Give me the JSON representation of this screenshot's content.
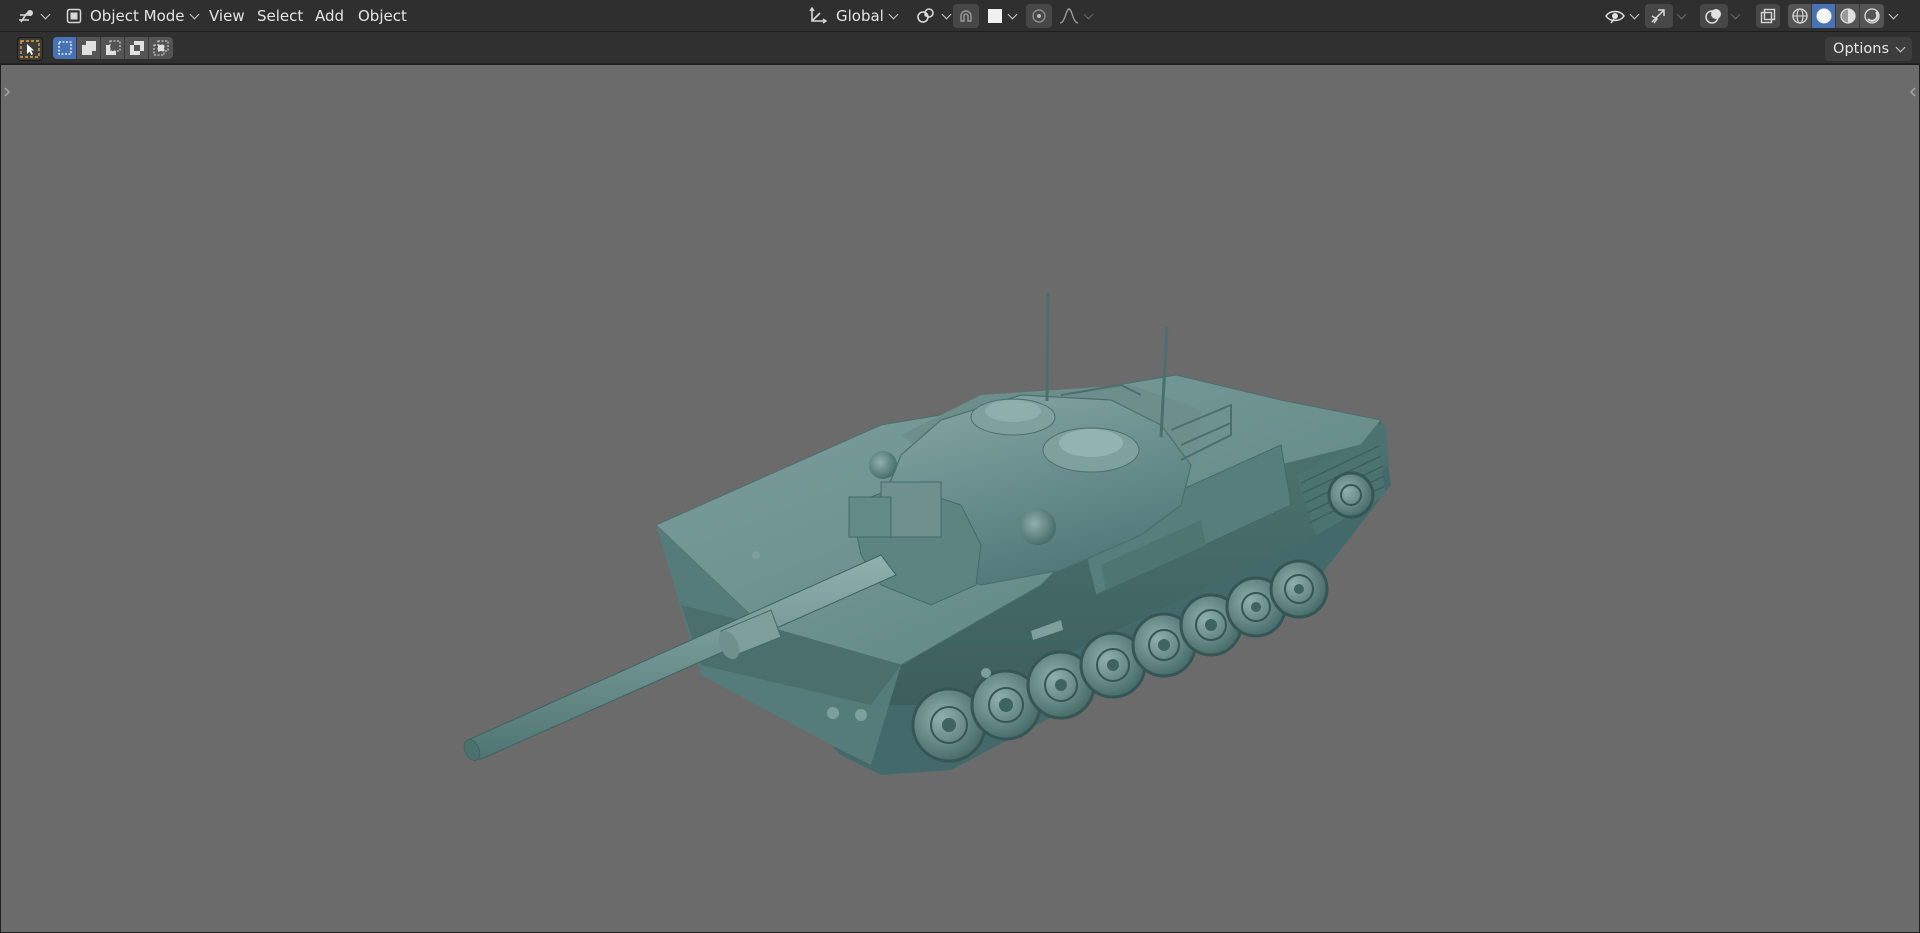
{
  "header": {
    "editor_type_icon": "viewport-gizmo-icon",
    "mode_icon": "object-mode-icon",
    "mode_label": "Object Mode",
    "menus": [
      "View",
      "Select",
      "Add",
      "Object"
    ],
    "transform_orientation_icon": "axes-orientation-icon",
    "transform_orientation_label": "Global",
    "pivot_icon": "pivot-point-icon",
    "snap_icon": "magnet-snap-icon",
    "snap_target_icon": "snap-increment-icon",
    "proportional_edit_icon": "proportional-edit-icon",
    "falloff_icon": "falloff-curve-icon",
    "visibility_icon": "eye-visibility-icon",
    "gizmo_icon": "gizmo-arrow-icon",
    "overlays_icon": "overlays-icon",
    "xray_icon": "xray-toggle-icon",
    "shading_modes": [
      {
        "name": "wireframe-shading-icon"
      },
      {
        "name": "solid-shading-icon",
        "active": true
      },
      {
        "name": "material-preview-icon"
      },
      {
        "name": "rendered-shading-icon"
      }
    ]
  },
  "toolbar": {
    "active_tool_icon": "select-box-tool-icon",
    "selection_modes": [
      {
        "name": "select-new-icon",
        "active": true
      },
      {
        "name": "select-extend-icon"
      },
      {
        "name": "select-subtract-icon"
      },
      {
        "name": "select-invert-icon"
      },
      {
        "name": "select-intersect-icon"
      }
    ],
    "options_label": "Options"
  },
  "viewport": {
    "background_color": "#6b6b6b",
    "model_color": "#5f8785",
    "model_name": "tank-model"
  },
  "colors": {
    "accent": "#4772b3",
    "header_bg": "#2f2f2f",
    "tool_highlight": "#e8a43c"
  }
}
